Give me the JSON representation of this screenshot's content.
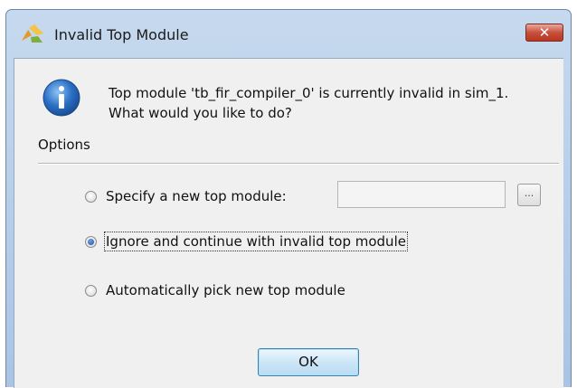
{
  "window": {
    "title": "Invalid Top Module",
    "close_glyph": "✕"
  },
  "message": {
    "line1": "Top module 'tb_fir_compiler_0' is currently invalid in sim_1.",
    "line2": "What would you like to do?",
    "icon": "info-icon"
  },
  "options": {
    "label": "Options",
    "items": [
      {
        "label": "Specify a new top module:",
        "checked": false
      },
      {
        "label": "Ignore and continue with invalid top module",
        "checked": true
      },
      {
        "label": "Automatically pick new top module",
        "checked": false
      }
    ],
    "module_input_value": "",
    "browse_label": "..."
  },
  "ok_button": {
    "label": "OK"
  },
  "colors": {
    "title_bar": "#b9cfe9",
    "client_bg": "#f0f0f0",
    "close_button": "#c9503c",
    "info_icon": "#2a6fc4",
    "selected_radio": "#1f4f9b"
  }
}
